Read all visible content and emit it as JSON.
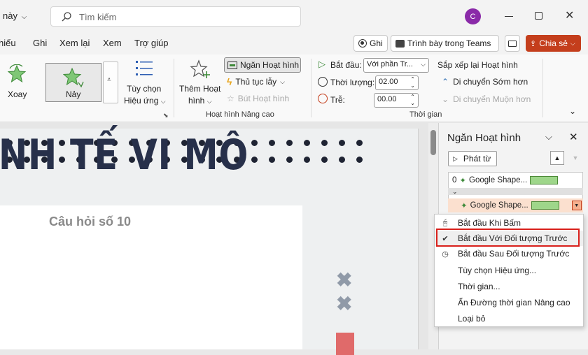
{
  "titlebar": {
    "left_fragment": "này",
    "search_placeholder": "Tìm kiếm",
    "avatar_letter": "C"
  },
  "menu": {
    "items": [
      "hiếu",
      "Ghi",
      "Xem lại",
      "Xem",
      "Trợ giúp"
    ],
    "record_button": "Ghi",
    "teams_button": "Trình bày trong Teams",
    "share_button": "Chia sẻ"
  },
  "ribbon": {
    "gallery": {
      "item1": "Xoay",
      "item2": "Nảy"
    },
    "effect_options": {
      "line1": "Tùy chọn",
      "line2": "Hiệu ứng"
    },
    "add_animation": {
      "line1": "Thêm Hoạt",
      "line2": "hình"
    },
    "animation_pane_button": "Ngăn Hoạt hình",
    "trigger_button": "Thủ tục lẫy",
    "painter_button": "Bút Hoạt hình",
    "group_advanced": "Hoạt hình Nâng cao",
    "start_label": "Bắt đầu:",
    "start_value": "Với phần Tr...",
    "duration_label": "Thời lượng:",
    "duration_value": "02.00",
    "delay_label": "Trễ:",
    "delay_value": "00.00",
    "reorder_title": "Sắp xếp lại Hoạt hình",
    "move_earlier": "Di chuyển Sớm hơn",
    "move_later": "Di chuyển Muộn hơn",
    "group_timing": "Thời gian"
  },
  "slide": {
    "title": "NH TẾ VI MÔ",
    "subtitle": "Câu hỏi số 10"
  },
  "pane": {
    "title": "Ngăn Hoạt hình",
    "play_button": "Phát từ",
    "items": [
      {
        "index": "0",
        "label": "Google Shape..."
      },
      {
        "index": "",
        "label": "Google Shape..."
      }
    ]
  },
  "dropdown": {
    "items": [
      "Bắt đầu Khi Bấm",
      "Bắt đầu Với Đối tượng Trước",
      "Bắt đầu Sau Đối tượng Trước",
      "Tùy chọn Hiệu ứng...",
      "Thời gian...",
      "Ẩn Đường thời gian Nâng cao",
      "Loại bỏ"
    ]
  },
  "colors": {
    "share": "#c43e1c",
    "highlight": "#d9201b",
    "avatar": "#8a2aa8",
    "green_bar": "#9ed68a"
  }
}
